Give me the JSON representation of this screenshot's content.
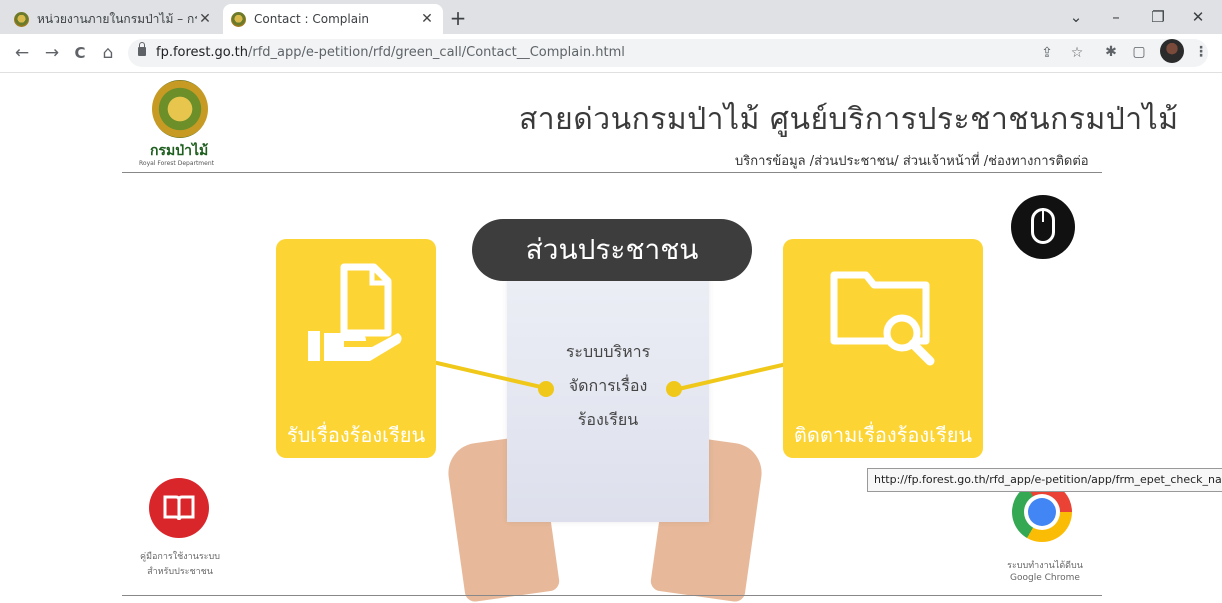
{
  "browser": {
    "tabs": [
      {
        "title": "หน่วยงานภายในกรมป่าไม้ – กรมป่าไม้",
        "active": false
      },
      {
        "title": "Contact : Complain",
        "active": true
      }
    ],
    "new_tab": "+",
    "window_controls": {
      "chevron": "⌄",
      "minimize": "–",
      "restore": "❐",
      "close": "✕"
    },
    "nav": {
      "back": "←",
      "forward": "→",
      "reload": "C",
      "home": "⌂"
    },
    "url_host": "fp.forest.go.th",
    "url_path": "/rfd_app/e-petition/rfd/green_call/Contact__Complain.html",
    "toolbar_icons": {
      "share": "⇪",
      "bookmark": "☆",
      "extensions": "✱",
      "sidepanel": "▢",
      "menu": "⋮"
    }
  },
  "page": {
    "logo_text": "กรมป่าไม้",
    "logo_sub": "Royal Forest Department",
    "title": "สายด่วนกรมป่าไม้  ศูนย์บริการประชาชนกรมป่าไม้",
    "subtitle": "บริการข้อมูล /ส่วนประชาชน/ ส่วนเจ้าหน้าที่ /ช่องทางการติดต่อ",
    "section_label": "ส่วนประชาชน",
    "paper_lines": [
      "ระบบบริหาร",
      "จัดการเรื่อง",
      "ร้องเรียน"
    ],
    "card_left_label": "รับเรื่องร้องเรียน",
    "card_right_label": "ติดตามเรื่องร้องเรียน",
    "manual_lines": [
      "คู่มือการใช้งานระบบ",
      "สำหรับประชาชน"
    ],
    "chrome_lines": [
      "ระบบทำงานได้ดีบน",
      "Google Chrome"
    ],
    "status_url": "http://fp.forest.go.th/rfd_app/e-petition/app/frm_epet_check_name.php"
  }
}
